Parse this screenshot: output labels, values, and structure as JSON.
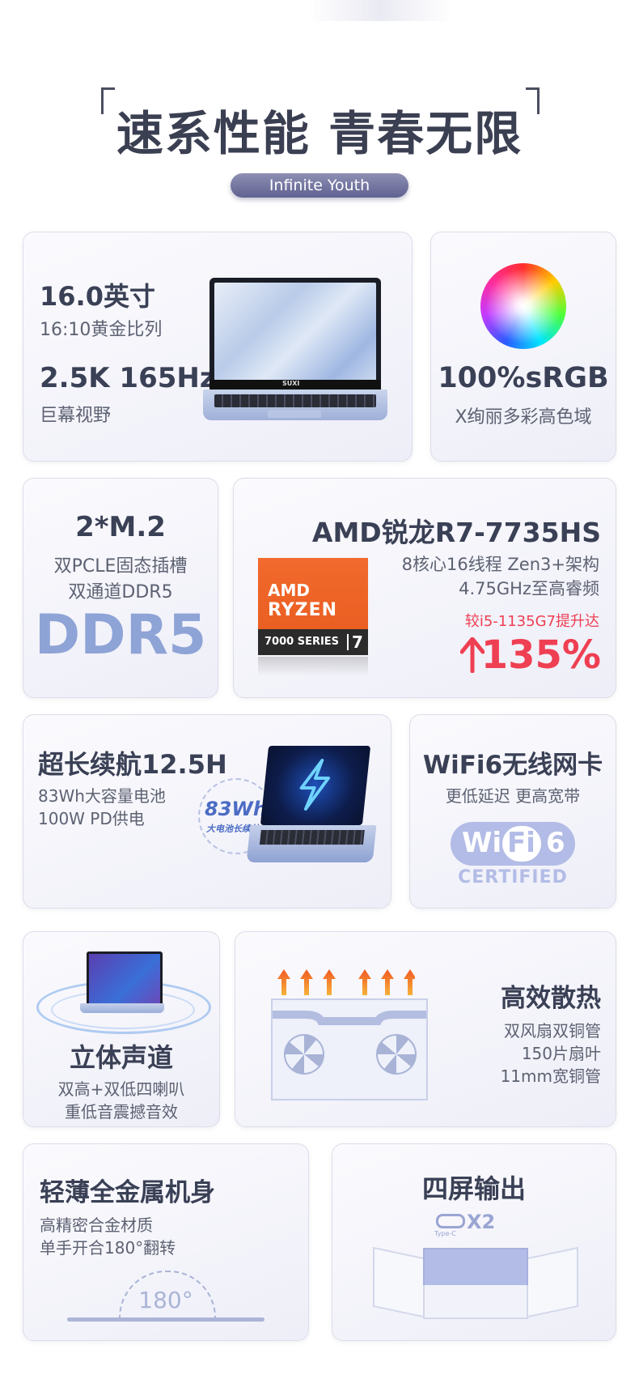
{
  "header": {
    "headline": "速系性能 青春无限",
    "tagline": "Infinite Youth"
  },
  "display": {
    "size": "16.0英寸",
    "ratio": "16:10黄金比列",
    "resolution": "2.5K 165Hz",
    "view": "巨幕视野",
    "brand_on_laptop": "SUXI"
  },
  "color_gamut": {
    "title": "100%sRGB",
    "subtitle": "X绚丽多彩高色域"
  },
  "storage": {
    "title": "2*M.2",
    "line1": "双PCLE固态插槽",
    "line2": "双通道DDR5",
    "badge": "DDR5"
  },
  "cpu": {
    "title": "AMD锐龙R7-7735HS",
    "line1": "8核心16线程 Zen3+架构",
    "line2": "4.75GHz至高睿频",
    "compare": "较i5-1135G7提升达",
    "boost": "135%",
    "logo_brand": "AMD",
    "logo_name": "RYZEN",
    "logo_series": "7000 SERIES",
    "logo_tier": "7",
    "accent_color": "#ef3f52"
  },
  "battery": {
    "title": "超长续航12.5H",
    "line1": "83Wh大容量电池",
    "line2": "100W PD供电",
    "badge_value": "83Wh",
    "badge_text": "大电池长续航"
  },
  "wifi": {
    "title": "WiFi6无线网卡",
    "subtitle": "更低延迟 更高宽带",
    "logo_wi": "Wi",
    "logo_fi": "Fi",
    "logo_num": "6",
    "logo_cert": "CERTIFIED"
  },
  "audio": {
    "title": "立体声道",
    "line1": "双高+双低四喇叭",
    "line2": "重低音震撼音效"
  },
  "cooling": {
    "title": "高效散热",
    "line1": "双风扇双铜管",
    "line2": "150片扇叶",
    "line3": "11mm宽铜管"
  },
  "body": {
    "title": "轻薄全金属机身",
    "line1": "高精密合金材质",
    "line2": "单手开合180°翻转",
    "angle": "180°"
  },
  "screens": {
    "title": "四屏输出",
    "port_count": "X2",
    "port_label": "Type-C"
  }
}
